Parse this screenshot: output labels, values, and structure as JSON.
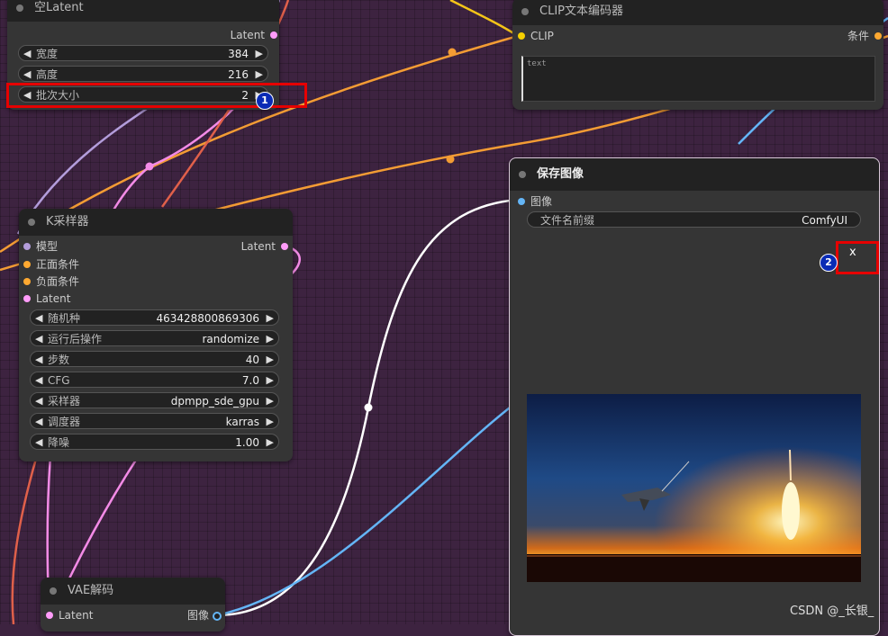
{
  "nodes": {
    "empty_latent": {
      "title": "空Latent",
      "output": "Latent",
      "widgets": [
        {
          "label": "宽度",
          "value": "384"
        },
        {
          "label": "高度",
          "value": "216"
        },
        {
          "label": "批次大小",
          "value": "2"
        }
      ]
    },
    "clip": {
      "title": "CLIP文本编码器",
      "input": "CLIP",
      "output": "条件",
      "text_placeholder": "text"
    },
    "ksampler": {
      "title": "K采样器",
      "inputs": [
        "模型",
        "正面条件",
        "负面条件",
        "Latent"
      ],
      "output": "Latent",
      "widgets": [
        {
          "label": "随机种",
          "value": "463428800869306"
        },
        {
          "label": "运行后操作",
          "value": "randomize"
        },
        {
          "label": "步数",
          "value": "40"
        },
        {
          "label": "CFG",
          "value": "7.0"
        },
        {
          "label": "采样器",
          "value": "dpmpp_sde_gpu"
        },
        {
          "label": "调度器",
          "value": "karras"
        },
        {
          "label": "降噪",
          "value": "1.00"
        }
      ]
    },
    "save": {
      "title": "保存图像",
      "input": "图像",
      "widget": {
        "label": "文件名前缀",
        "value": "ComfyUI"
      },
      "close_text": "x"
    },
    "vae": {
      "title": "VAE解码",
      "input": "Latent",
      "output": "图像"
    }
  },
  "annotations": {
    "one": "1",
    "two": "2"
  },
  "watermark": "CSDN @_长银_",
  "colors": {
    "canvas": "#3d2340",
    "node_bg": "#353535",
    "title_bg": "#222222",
    "highlight": "#e60000",
    "latent_slot": "#ff9cf9",
    "conditioning_slot": "#ffa931",
    "clip_slot": "#ffd500",
    "image_slot": "#64b5f6",
    "model_slot": "#b39ddb"
  }
}
